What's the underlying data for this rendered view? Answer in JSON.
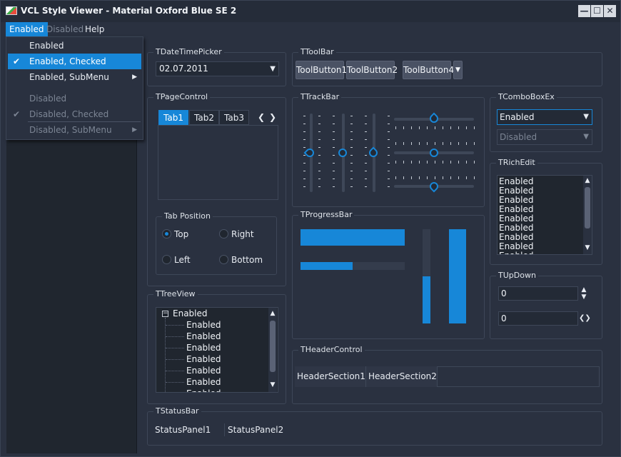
{
  "window": {
    "title": "VCL Style Viewer - Material Oxford Blue SE 2"
  },
  "menubar": {
    "items": [
      "Enabled",
      "Disabled",
      "Help"
    ]
  },
  "dropdown": {
    "items": [
      {
        "label": "Enabled",
        "checked": false,
        "submenu": false,
        "disabled": false
      },
      {
        "label": "Enabled, Checked",
        "checked": true,
        "submenu": false,
        "disabled": false
      },
      {
        "label": "Enabled, SubMenu",
        "checked": false,
        "submenu": true,
        "disabled": false
      },
      {
        "label": "Disabled",
        "checked": false,
        "submenu": false,
        "disabled": true
      },
      {
        "label": "Disabled, Checked",
        "checked": true,
        "submenu": false,
        "disabled": true
      },
      {
        "label": "Disabled, SubMenu",
        "checked": false,
        "submenu": true,
        "disabled": true
      }
    ]
  },
  "groups": {
    "datetimepicker": "TDateTimePicker",
    "toolbar": "TToolBar",
    "pagecontrol": "TPageControl",
    "trackbar": "TTrackBar",
    "comboboxex": "TComboBoxEx",
    "tabposition": "Tab Position",
    "richedit": "TRichEdit",
    "progressbar": "TProgressBar",
    "treeview": "TTreeView",
    "updown": "TUpDown",
    "headercontrol": "THeaderControl",
    "statusbar": "TStatusBar"
  },
  "datetimepicker": {
    "value": "02.07.2011"
  },
  "toolbar": {
    "buttons": [
      "ToolButton1",
      "ToolButton2",
      "ToolButton4"
    ]
  },
  "pagecontrol": {
    "tabs": [
      "Tab1",
      "Tab2",
      "Tab3"
    ]
  },
  "comboboxex": {
    "enabled_value": "Enabled",
    "disabled_value": "Disabled"
  },
  "tabposition": {
    "options": [
      "Top",
      "Right",
      "Left",
      "Bottom"
    ],
    "selected": "Top"
  },
  "richedit": {
    "lines": [
      "Enabled",
      "Enabled",
      "Enabled",
      "Enabled",
      "Enabled",
      "Enabled",
      "Enabled",
      "Enabled",
      "Enabled",
      "Enabled"
    ]
  },
  "progressbar": {
    "h1": 1.0,
    "h2": 0.5,
    "v1": 0.5,
    "v2": 1.0
  },
  "treeview": {
    "root": "Enabled",
    "children": [
      "Enabled",
      "Enabled",
      "Enabled",
      "Enabled",
      "Enabled",
      "Enabled",
      "Enabled"
    ]
  },
  "updown": {
    "value1": "0",
    "value2": "0"
  },
  "headercontrol": {
    "sections": [
      "HeaderSection1",
      "HeaderSection2"
    ]
  },
  "statusbar": {
    "panels": [
      "StatusPanel1",
      "StatusPanel2"
    ]
  },
  "icons": {
    "minimize": "—",
    "maximize": "☐",
    "close": "✕"
  },
  "colors": {
    "accent": "#1787d8",
    "background": "#2a3140"
  }
}
